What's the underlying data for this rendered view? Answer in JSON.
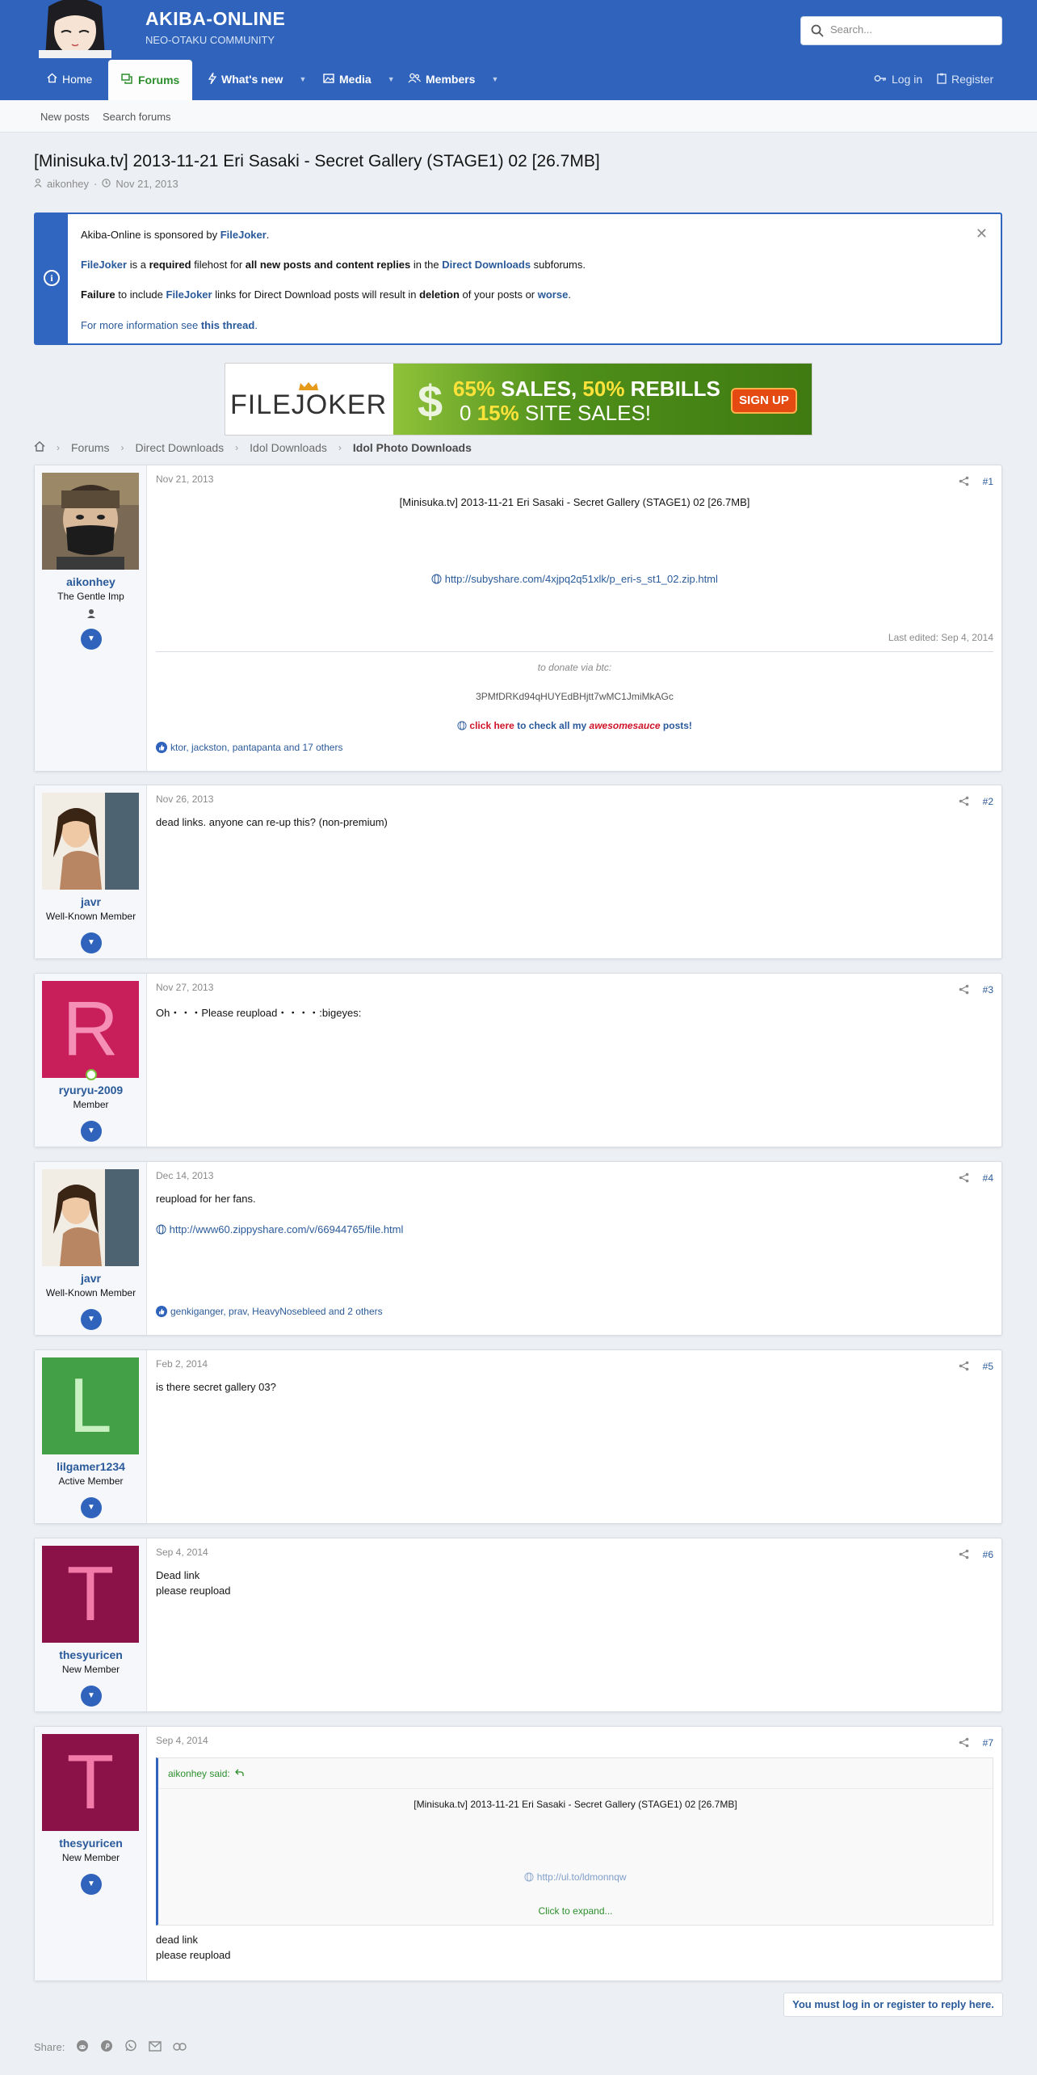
{
  "site": {
    "title": "AKIBA-ONLINE",
    "tagline": "NEO-OTAKU COMMUNITY",
    "search_placeholder": "Search..."
  },
  "nav": {
    "home": "Home",
    "forums": "Forums",
    "whats_new": "What's new",
    "media": "Media",
    "members": "Members",
    "login": "Log in",
    "register": "Register"
  },
  "subnav": {
    "new_posts": "New posts",
    "search_forums": "Search forums"
  },
  "thread": {
    "title": "[Minisuka.tv] 2013-11-21 Eri Sasaki - Secret Gallery (STAGE1) 02 [26.7MB]",
    "author": "aikonhey",
    "date": "Nov 21, 2013"
  },
  "notice": {
    "l1_a": "Akiba-Online is sponsored by ",
    "l1_b": "FileJoker",
    "l1_c": ".",
    "l2_a": "FileJoker",
    "l2_b": " is a ",
    "l2_c": "required",
    "l2_d": " filehost for ",
    "l2_e": "all new posts and content replies",
    "l2_f": " in the ",
    "l2_g": "Direct Downloads",
    "l2_h": " subforums.",
    "l3_a": "Failure",
    "l3_b": " to include ",
    "l3_c": "FileJoker",
    "l3_d": " links for Direct Download posts will result in ",
    "l3_e": "deletion",
    "l3_f": " of your posts or ",
    "l3_g": "worse",
    "l3_h": ".",
    "l4_a": "For more information see ",
    "l4_b": "this thread",
    "l4_c": "."
  },
  "banner": {
    "brand": "FILEJOKER",
    "line1_a": "65%",
    "line1_b": " SALES, ",
    "line1_c": "50%",
    "line1_d": " REBILLS",
    "line2_a": "0",
    "line2_b": " 15%",
    "line2_c": " SITE SALES!",
    "cta": "SIGN UP"
  },
  "breadcrumb": [
    "Forums",
    "Direct Downloads",
    "Idol Downloads",
    "Idol Photo Downloads"
  ],
  "posts": [
    {
      "user": "aikonhey",
      "user_title": "The Gentle Imp",
      "date": "Nov 21, 2013",
      "num": "#1",
      "title": "[Minisuka.tv] 2013-11-21 Eri Sasaki - Secret Gallery (STAGE1) 02 [26.7MB]",
      "link": "http://subyshare.com/4xjpq2q51xlk/p_eri-s_st1_02.zip.html",
      "last_edited": "Last edited: Sep 4, 2014",
      "sig_donate": "to donate via btc:",
      "sig_btc": "3PMfDRKd94qHUYEdBHjtt7wMC1JmiMkAGc",
      "sig_a": "click here",
      "sig_b": " to check all my ",
      "sig_c": "awesomesauce",
      "sig_d": " posts!",
      "reactions": "ktor, jackston, pantapanta and 17 others"
    },
    {
      "user": "javr",
      "user_title": "Well-Known Member",
      "date": "Nov 26, 2013",
      "num": "#2",
      "text": "dead links. anyone can re-up this? (non-premium)"
    },
    {
      "user": "ryuryu-2009",
      "user_title": "Member",
      "date": "Nov 27, 2013",
      "num": "#3",
      "letter": "R",
      "text": "Oh・・・Please reupload・・・・:bigeyes:"
    },
    {
      "user": "javr",
      "user_title": "Well-Known Member",
      "date": "Dec 14, 2013",
      "num": "#4",
      "text": "reupload for her fans.",
      "link": "http://www60.zippyshare.com/v/66944765/file.html",
      "reactions": "genkiganger, prav, HeavyNosebleed and 2 others"
    },
    {
      "user": "lilgamer1234",
      "user_title": "Active Member",
      "date": "Feb 2, 2014",
      "num": "#5",
      "letter": "L",
      "text": "is there secret gallery 03?"
    },
    {
      "user": "thesyuricen",
      "user_title": "New Member",
      "date": "Sep 4, 2014",
      "num": "#6",
      "letter": "T",
      "text1": "Dead link",
      "text2": "please reupload"
    },
    {
      "user": "thesyuricen",
      "user_title": "New Member",
      "date": "Sep 4, 2014",
      "num": "#7",
      "letter": "T",
      "quote_author": "aikonhey said:",
      "quote_title": "[Minisuka.tv] 2013-11-21 Eri Sasaki - Secret Gallery (STAGE1) 02 [26.7MB]",
      "quote_link": "http://ul.to/ldmonnqw",
      "quote_expand": "Click to expand...",
      "text1": "dead link",
      "text2": "please reupload"
    }
  ],
  "footer": {
    "reply_notice": "You must log in or register to reply here.",
    "share_label": "Share:"
  },
  "colors": {
    "brand_blue": "#2f63bc",
    "active_green": "#2c8f2c",
    "link_blue": "#2a5a9a"
  }
}
